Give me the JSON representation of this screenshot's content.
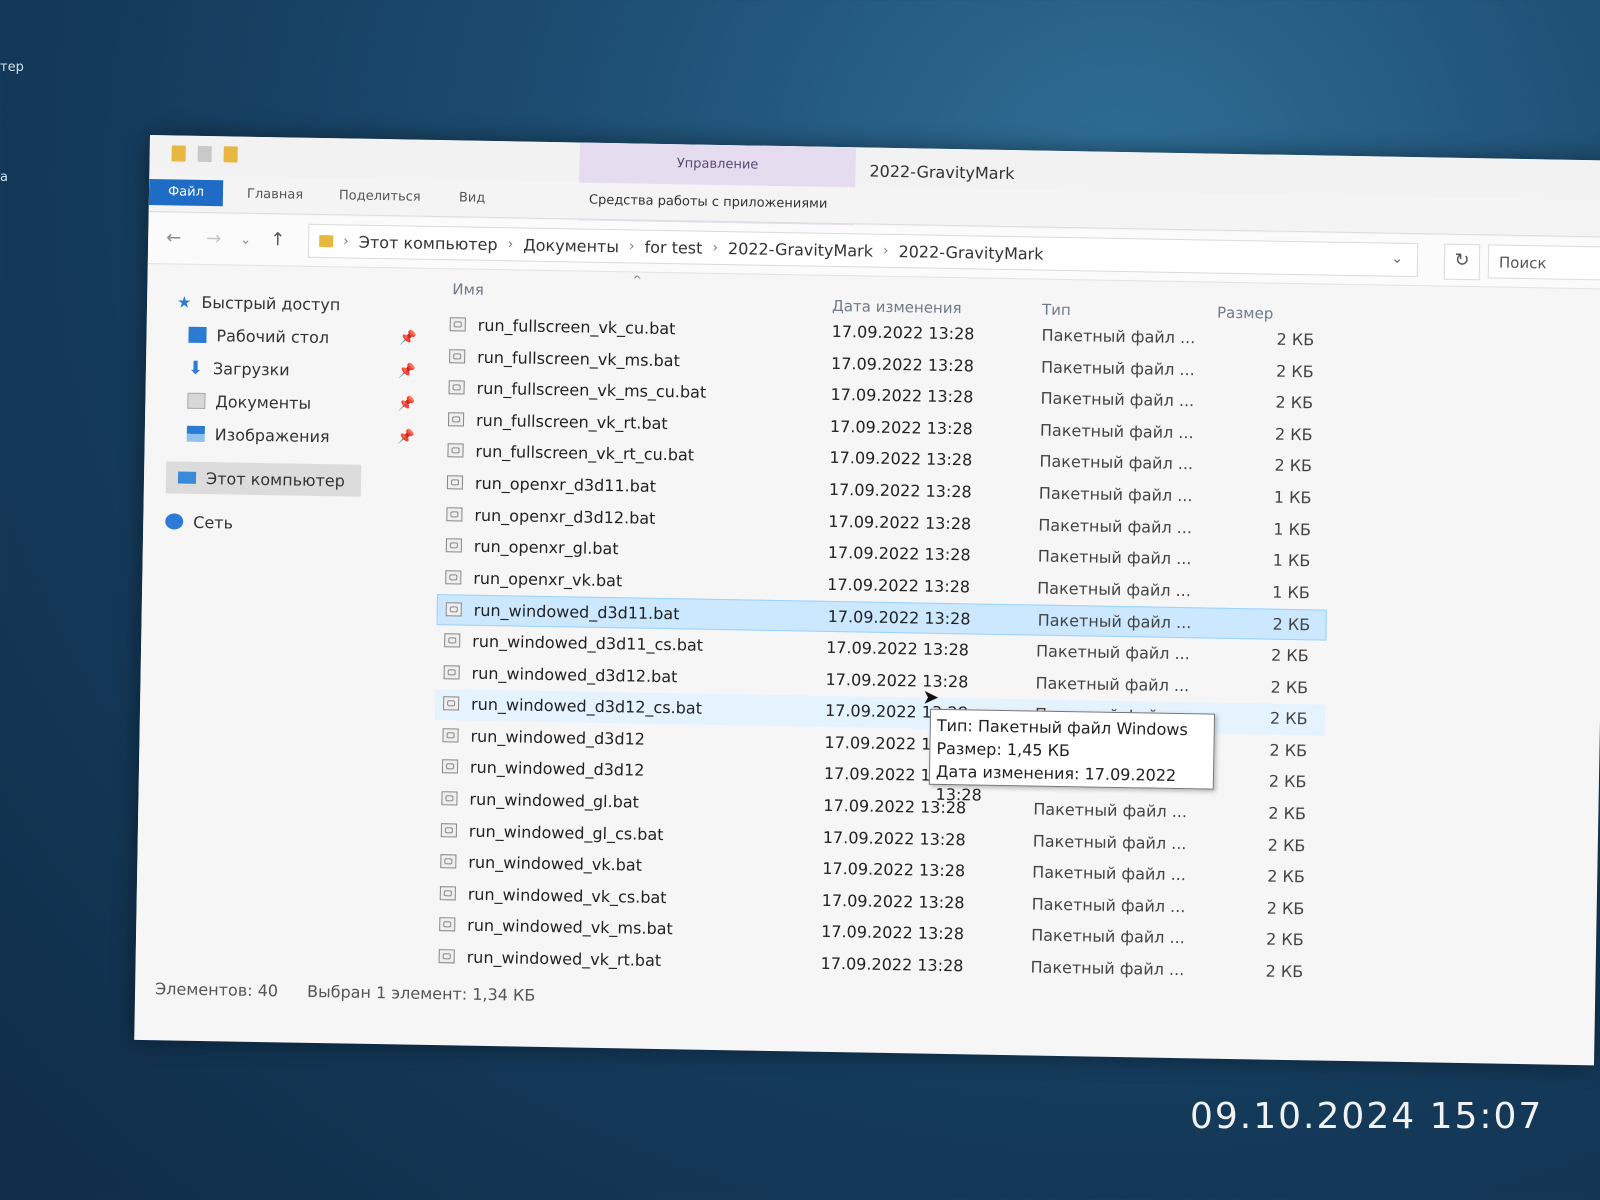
{
  "desktop": {
    "edge_labels": [
      "тер",
      "а"
    ]
  },
  "window": {
    "title": "2022-GravityMark",
    "manage_tab": "Управление",
    "ribbon_tabs": [
      {
        "label": "Файл"
      },
      {
        "label": "Главная"
      },
      {
        "label": "Поделиться"
      },
      {
        "label": "Вид"
      }
    ],
    "tools_tab": "Средства работы с приложениями"
  },
  "address": {
    "crumbs": [
      "Этот компьютер",
      "Документы",
      "for test",
      "2022-GravityMark",
      "2022-GravityMark"
    ],
    "search_placeholder": "Поиск"
  },
  "sidebar": {
    "items": [
      {
        "label": "Быстрый доступ",
        "icon": "star-icon"
      },
      {
        "label": "Рабочий стол",
        "icon": "desktop-icon",
        "pinned": true
      },
      {
        "label": "Загрузки",
        "icon": "download-icon",
        "pinned": true
      },
      {
        "label": "Документы",
        "icon": "documents-icon",
        "pinned": true
      },
      {
        "label": "Изображения",
        "icon": "pictures-icon",
        "pinned": true
      },
      {
        "label": "Этот компьютер",
        "icon": "computer-icon"
      },
      {
        "label": "Сеть",
        "icon": "network-icon"
      }
    ]
  },
  "columns": {
    "name": "Имя",
    "date": "Дата изменения",
    "type": "Тип",
    "size": "Размер"
  },
  "files": [
    {
      "name": "run_fullscreen_vk_cu.bat",
      "date": "17.09.2022 13:28",
      "type": "Пакетный файл ...",
      "size": "2 КБ"
    },
    {
      "name": "run_fullscreen_vk_ms.bat",
      "date": "17.09.2022 13:28",
      "type": "Пакетный файл ...",
      "size": "2 КБ"
    },
    {
      "name": "run_fullscreen_vk_ms_cu.bat",
      "date": "17.09.2022 13:28",
      "type": "Пакетный файл ...",
      "size": "2 КБ"
    },
    {
      "name": "run_fullscreen_vk_rt.bat",
      "date": "17.09.2022 13:28",
      "type": "Пакетный файл ...",
      "size": "2 КБ"
    },
    {
      "name": "run_fullscreen_vk_rt_cu.bat",
      "date": "17.09.2022 13:28",
      "type": "Пакетный файл ...",
      "size": "2 КБ"
    },
    {
      "name": "run_openxr_d3d11.bat",
      "date": "17.09.2022 13:28",
      "type": "Пакетный файл ...",
      "size": "1 КБ"
    },
    {
      "name": "run_openxr_d3d12.bat",
      "date": "17.09.2022 13:28",
      "type": "Пакетный файл ...",
      "size": "1 КБ"
    },
    {
      "name": "run_openxr_gl.bat",
      "date": "17.09.2022 13:28",
      "type": "Пакетный файл ...",
      "size": "1 КБ"
    },
    {
      "name": "run_openxr_vk.bat",
      "date": "17.09.2022 13:28",
      "type": "Пакетный файл ...",
      "size": "1 КБ"
    },
    {
      "name": "run_windowed_d3d11.bat",
      "date": "17.09.2022 13:28",
      "type": "Пакетный файл ...",
      "size": "2 КБ",
      "state": "selected"
    },
    {
      "name": "run_windowed_d3d11_cs.bat",
      "date": "17.09.2022 13:28",
      "type": "Пакетный файл ...",
      "size": "2 КБ"
    },
    {
      "name": "run_windowed_d3d12.bat",
      "date": "17.09.2022 13:28",
      "type": "Пакетный файл ...",
      "size": "2 КБ"
    },
    {
      "name": "run_windowed_d3d12_cs.bat",
      "date": "17.09.2022 13:28",
      "type": "Пакетный файл ...",
      "size": "2 КБ",
      "state": "hover"
    },
    {
      "name": "run_windowed_d3d12",
      "date": "17.09.2022 13:28",
      "type": "Пакетный файл ...",
      "size": "2 КБ"
    },
    {
      "name": "run_windowed_d3d12",
      "date": "17.09.2022 13:28",
      "type": "Пакетный файл ...",
      "size": "2 КБ"
    },
    {
      "name": "run_windowed_gl.bat",
      "date": "17.09.2022 13:28",
      "type": "Пакетный файл ...",
      "size": "2 КБ"
    },
    {
      "name": "run_windowed_gl_cs.bat",
      "date": "17.09.2022 13:28",
      "type": "Пакетный файл ...",
      "size": "2 КБ"
    },
    {
      "name": "run_windowed_vk.bat",
      "date": "17.09.2022 13:28",
      "type": "Пакетный файл ...",
      "size": "2 КБ"
    },
    {
      "name": "run_windowed_vk_cs.bat",
      "date": "17.09.2022 13:28",
      "type": "Пакетный файл ...",
      "size": "2 КБ"
    },
    {
      "name": "run_windowed_vk_ms.bat",
      "date": "17.09.2022 13:28",
      "type": "Пакетный файл ...",
      "size": "2 КБ"
    },
    {
      "name": "run_windowed_vk_rt.bat",
      "date": "17.09.2022 13:28",
      "type": "Пакетный файл ...",
      "size": "2 КБ"
    }
  ],
  "tooltip": {
    "type": "Тип: Пакетный файл Windows",
    "size": "Размер: 1,45 КБ",
    "date": "Дата изменения: 17.09.2022 13:28"
  },
  "status": {
    "count": "Элементов: 40",
    "selected": "Выбран 1 элемент: 1,34 КБ"
  },
  "photo_timestamp": "09.10.2024 15:07"
}
